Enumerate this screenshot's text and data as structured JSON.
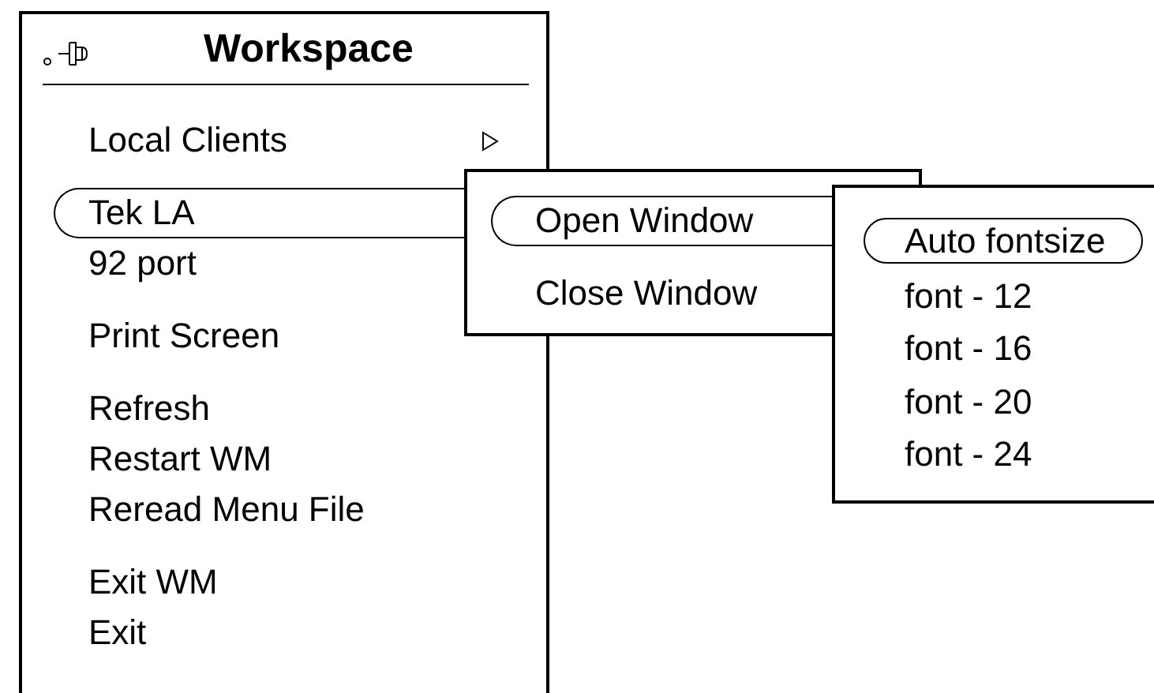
{
  "menu": {
    "title": "Workspace",
    "groups": [
      [
        {
          "label": "Local Clients",
          "selected": false,
          "arrow": true
        }
      ],
      [
        {
          "label": "Tek LA",
          "selected": true
        },
        {
          "label": "92 port",
          "selected": false
        }
      ],
      [
        {
          "label": "Print Screen",
          "selected": false
        }
      ],
      [
        {
          "label": "Refresh",
          "selected": false
        },
        {
          "label": "Restart WM",
          "selected": false
        },
        {
          "label": "Reread Menu File",
          "selected": false
        }
      ],
      [
        {
          "label": "Exit WM",
          "selected": false
        },
        {
          "label": "Exit",
          "selected": false
        }
      ]
    ]
  },
  "submenu": {
    "items": [
      {
        "label": "Open Window",
        "selected": true
      },
      {
        "label": "Close Window",
        "selected": false
      }
    ]
  },
  "font_submenu": {
    "items": [
      {
        "label": "Auto fontsize",
        "selected": true
      },
      {
        "label": "font - 12",
        "selected": false
      },
      {
        "label": "font - 16",
        "selected": false
      },
      {
        "label": "font - 20",
        "selected": false
      },
      {
        "label": "font - 24",
        "selected": false
      }
    ]
  }
}
